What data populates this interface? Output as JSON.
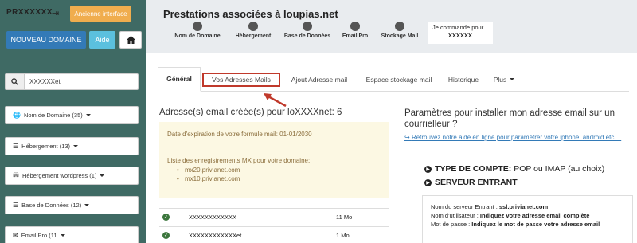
{
  "brand": "PRXXXXXX",
  "sidebar": {
    "old_interface_label": "Ancienne interface",
    "new_domain_label": "NOUVEAU DOMAINE",
    "help_label": "Aide",
    "search_value": "XXXXXXet",
    "items": [
      {
        "label": "Nom de Domaine (35)",
        "icon": "globe-icon"
      },
      {
        "label": "Hébergement (13)",
        "icon": "server-icon"
      },
      {
        "label": "Hébergement wordpress (1)",
        "icon": "wordpress-icon"
      },
      {
        "label": "Base de Données (12)",
        "icon": "database-icon"
      },
      {
        "label": "Email Pro (11",
        "icon": "envelope-icon"
      }
    ]
  },
  "header": {
    "title": "Prestations associées à loupias.net",
    "nav": [
      {
        "label": "Nom de Domaine",
        "icon": "globe-icon"
      },
      {
        "label": "Hébergement",
        "icon": "server-icon"
      },
      {
        "label": "Base de Données",
        "icon": "database-icon"
      },
      {
        "label": "Email Pro",
        "icon": "envelope-icon"
      },
      {
        "label": "Stockage Mail",
        "icon": "archive-icon"
      }
    ],
    "order_line1": "Je commande pour",
    "order_line2": "XXXXXX"
  },
  "tabs": [
    {
      "label": "Général"
    },
    {
      "label": "Vos Adresses Mails"
    },
    {
      "label": "Ajout Adresse mail"
    },
    {
      "label": "Espace stockage mail"
    },
    {
      "label": "Historique"
    },
    {
      "label": "Plus"
    }
  ],
  "main": {
    "left_title": "Adresse(s) email créée(s) pour loXXXXnet: 6",
    "expiry": "Date d'expiration de votre formule mail: 01-01/2030",
    "mx_title": "Liste des enregistrements MX pour votre domaine:",
    "mx_records": [
      "mx20.privianet.com",
      "mx10.privianet.com"
    ],
    "emails": [
      {
        "address": "XXXXXXXXXXXX",
        "size": "11 Mo"
      },
      {
        "address": "XXXXXXXXXXXXet",
        "size": "1 Mo"
      }
    ],
    "right_title": "Paramètres pour installer mon adresse email sur un courrielleur ?",
    "right_link": "Retrouvez notre aide en ligne pour paramétrer votre iphone, android etc ...",
    "account_type_label": "TYPE DE COMPTE:",
    "account_type_value": "POP ou IMAP (au choix)",
    "incoming_server_label": "SERVEUR ENTRANT",
    "server_name_label": "Nom du serveur Entrant :",
    "server_name_value": "ssl.privianet.com",
    "username_label": "Nom d'utilisateur :",
    "username_value": "Indiquez votre adresse email complète",
    "password_label": "Mot de passe :",
    "password_value": "Indiquez le mot de passe votre adresse email"
  }
}
